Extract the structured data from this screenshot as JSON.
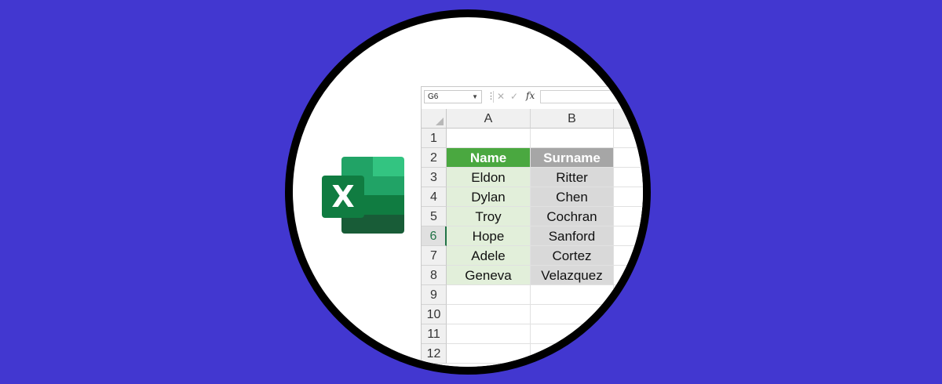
{
  "formula_bar": {
    "name_box": "G6",
    "fx_label": "fx",
    "formula": ""
  },
  "columns": [
    "A",
    "B"
  ],
  "rows": [
    {
      "num": "1",
      "a": "",
      "b": ""
    },
    {
      "num": "2",
      "a": "Name",
      "b": "Surname"
    },
    {
      "num": "3",
      "a": "Eldon",
      "b": "Ritter"
    },
    {
      "num": "4",
      "a": "Dylan",
      "b": "Chen"
    },
    {
      "num": "5",
      "a": "Troy",
      "b": "Cochran"
    },
    {
      "num": "6",
      "a": "Hope",
      "b": "Sanford"
    },
    {
      "num": "7",
      "a": "Adele",
      "b": "Cortez"
    },
    {
      "num": "8",
      "a": "Geneva",
      "b": "Velazquez"
    },
    {
      "num": "9",
      "a": "",
      "b": ""
    },
    {
      "num": "10",
      "a": "",
      "b": ""
    },
    {
      "num": "11",
      "a": "",
      "b": ""
    },
    {
      "num": "12",
      "a": "",
      "b": ""
    }
  ],
  "logo": {
    "letter": "X"
  },
  "colors": {
    "background": "#4237d0",
    "name_header": "#4aa840",
    "name_fill": "#e2efda",
    "surname_header": "#a6a6a6",
    "surname_fill": "#d9d9d9",
    "excel_green": "#107c41"
  }
}
